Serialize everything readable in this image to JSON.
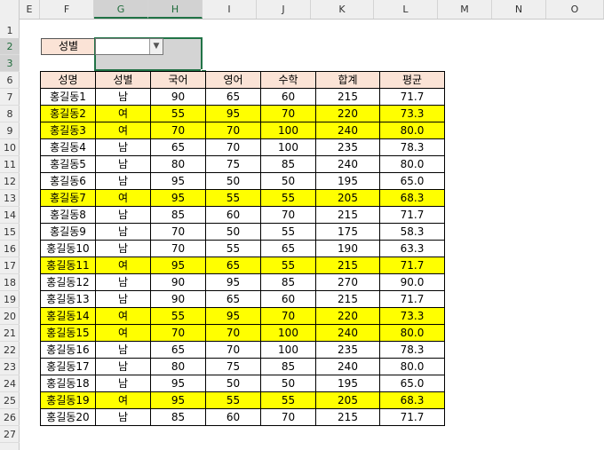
{
  "columns": [
    "E",
    "F",
    "G",
    "H",
    "I",
    "J",
    "K",
    "L",
    "M",
    "N",
    "O"
  ],
  "selected_columns": [
    "G",
    "H"
  ],
  "rows": [
    "1",
    "2",
    "3",
    "6",
    "7",
    "8",
    "9",
    "10",
    "11",
    "12",
    "13",
    "14",
    "15",
    "16",
    "17",
    "18",
    "19",
    "20",
    "21",
    "22",
    "23",
    "24",
    "25",
    "26",
    "27"
  ],
  "selected_rows": [
    "2",
    "3"
  ],
  "filter": {
    "label": "성별",
    "value": ""
  },
  "table": {
    "headers": [
      "성명",
      "성별",
      "국어",
      "영어",
      "수학",
      "합계",
      "평균"
    ],
    "rows": [
      {
        "cells": [
          "홍길동1",
          "남",
          "90",
          "65",
          "60",
          "215",
          "71.7"
        ],
        "highlight": false
      },
      {
        "cells": [
          "홍길동2",
          "여",
          "55",
          "95",
          "70",
          "220",
          "73.3"
        ],
        "highlight": true
      },
      {
        "cells": [
          "홍길동3",
          "여",
          "70",
          "70",
          "100",
          "240",
          "80.0"
        ],
        "highlight": true
      },
      {
        "cells": [
          "홍길동4",
          "남",
          "65",
          "70",
          "100",
          "235",
          "78.3"
        ],
        "highlight": false
      },
      {
        "cells": [
          "홍길동5",
          "남",
          "80",
          "75",
          "85",
          "240",
          "80.0"
        ],
        "highlight": false
      },
      {
        "cells": [
          "홍길동6",
          "남",
          "95",
          "50",
          "50",
          "195",
          "65.0"
        ],
        "highlight": false
      },
      {
        "cells": [
          "홍길동7",
          "여",
          "95",
          "55",
          "55",
          "205",
          "68.3"
        ],
        "highlight": true
      },
      {
        "cells": [
          "홍길동8",
          "남",
          "85",
          "60",
          "70",
          "215",
          "71.7"
        ],
        "highlight": false
      },
      {
        "cells": [
          "홍길동9",
          "남",
          "70",
          "50",
          "55",
          "175",
          "58.3"
        ],
        "highlight": false
      },
      {
        "cells": [
          "홍길동10",
          "남",
          "70",
          "55",
          "65",
          "190",
          "63.3"
        ],
        "highlight": false
      },
      {
        "cells": [
          "홍길동11",
          "여",
          "95",
          "65",
          "55",
          "215",
          "71.7"
        ],
        "highlight": true
      },
      {
        "cells": [
          "홍길동12",
          "남",
          "90",
          "95",
          "85",
          "270",
          "90.0"
        ],
        "highlight": false
      },
      {
        "cells": [
          "홍길동13",
          "남",
          "90",
          "65",
          "60",
          "215",
          "71.7"
        ],
        "highlight": false
      },
      {
        "cells": [
          "홍길동14",
          "여",
          "55",
          "95",
          "70",
          "220",
          "73.3"
        ],
        "highlight": true
      },
      {
        "cells": [
          "홍길동15",
          "여",
          "70",
          "70",
          "100",
          "240",
          "80.0"
        ],
        "highlight": true
      },
      {
        "cells": [
          "홍길동16",
          "남",
          "65",
          "70",
          "100",
          "235",
          "78.3"
        ],
        "highlight": false
      },
      {
        "cells": [
          "홍길동17",
          "남",
          "80",
          "75",
          "85",
          "240",
          "80.0"
        ],
        "highlight": false
      },
      {
        "cells": [
          "홍길동18",
          "남",
          "95",
          "50",
          "50",
          "195",
          "65.0"
        ],
        "highlight": false
      },
      {
        "cells": [
          "홍길동19",
          "여",
          "95",
          "55",
          "55",
          "205",
          "68.3"
        ],
        "highlight": true
      },
      {
        "cells": [
          "홍길동20",
          "남",
          "85",
          "60",
          "70",
          "215",
          "71.7"
        ],
        "highlight": false
      }
    ]
  },
  "colors": {
    "highlight": "#ffff00",
    "header_fill": "#fbe3d6",
    "selection": "#217346"
  }
}
